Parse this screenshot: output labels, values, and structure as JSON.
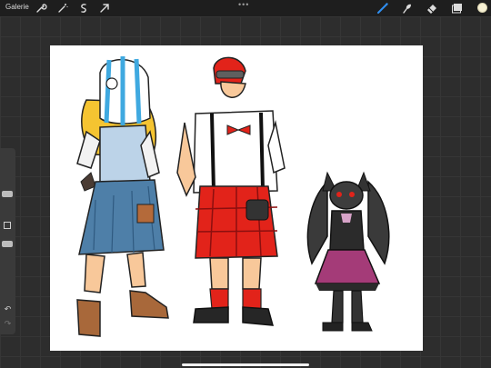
{
  "topbar": {
    "gallery_label": "Galerie",
    "more_dots": "•••",
    "left_tools": [
      "wrench-icon",
      "magic-wand-icon",
      "selection-icon",
      "transform-arrow-icon"
    ],
    "right_tools": [
      "brush-icon",
      "smudge-icon",
      "eraser-icon",
      "layers-icon"
    ],
    "brush_active_color": "#2f8ff2",
    "current_color": "#f7f1d4"
  },
  "sidebar": {
    "undo_icon": "undo-icon",
    "redo_icon": "redo-icon"
  },
  "canvas": {
    "background": "#ffffff",
    "artwork": "character-lineup"
  }
}
